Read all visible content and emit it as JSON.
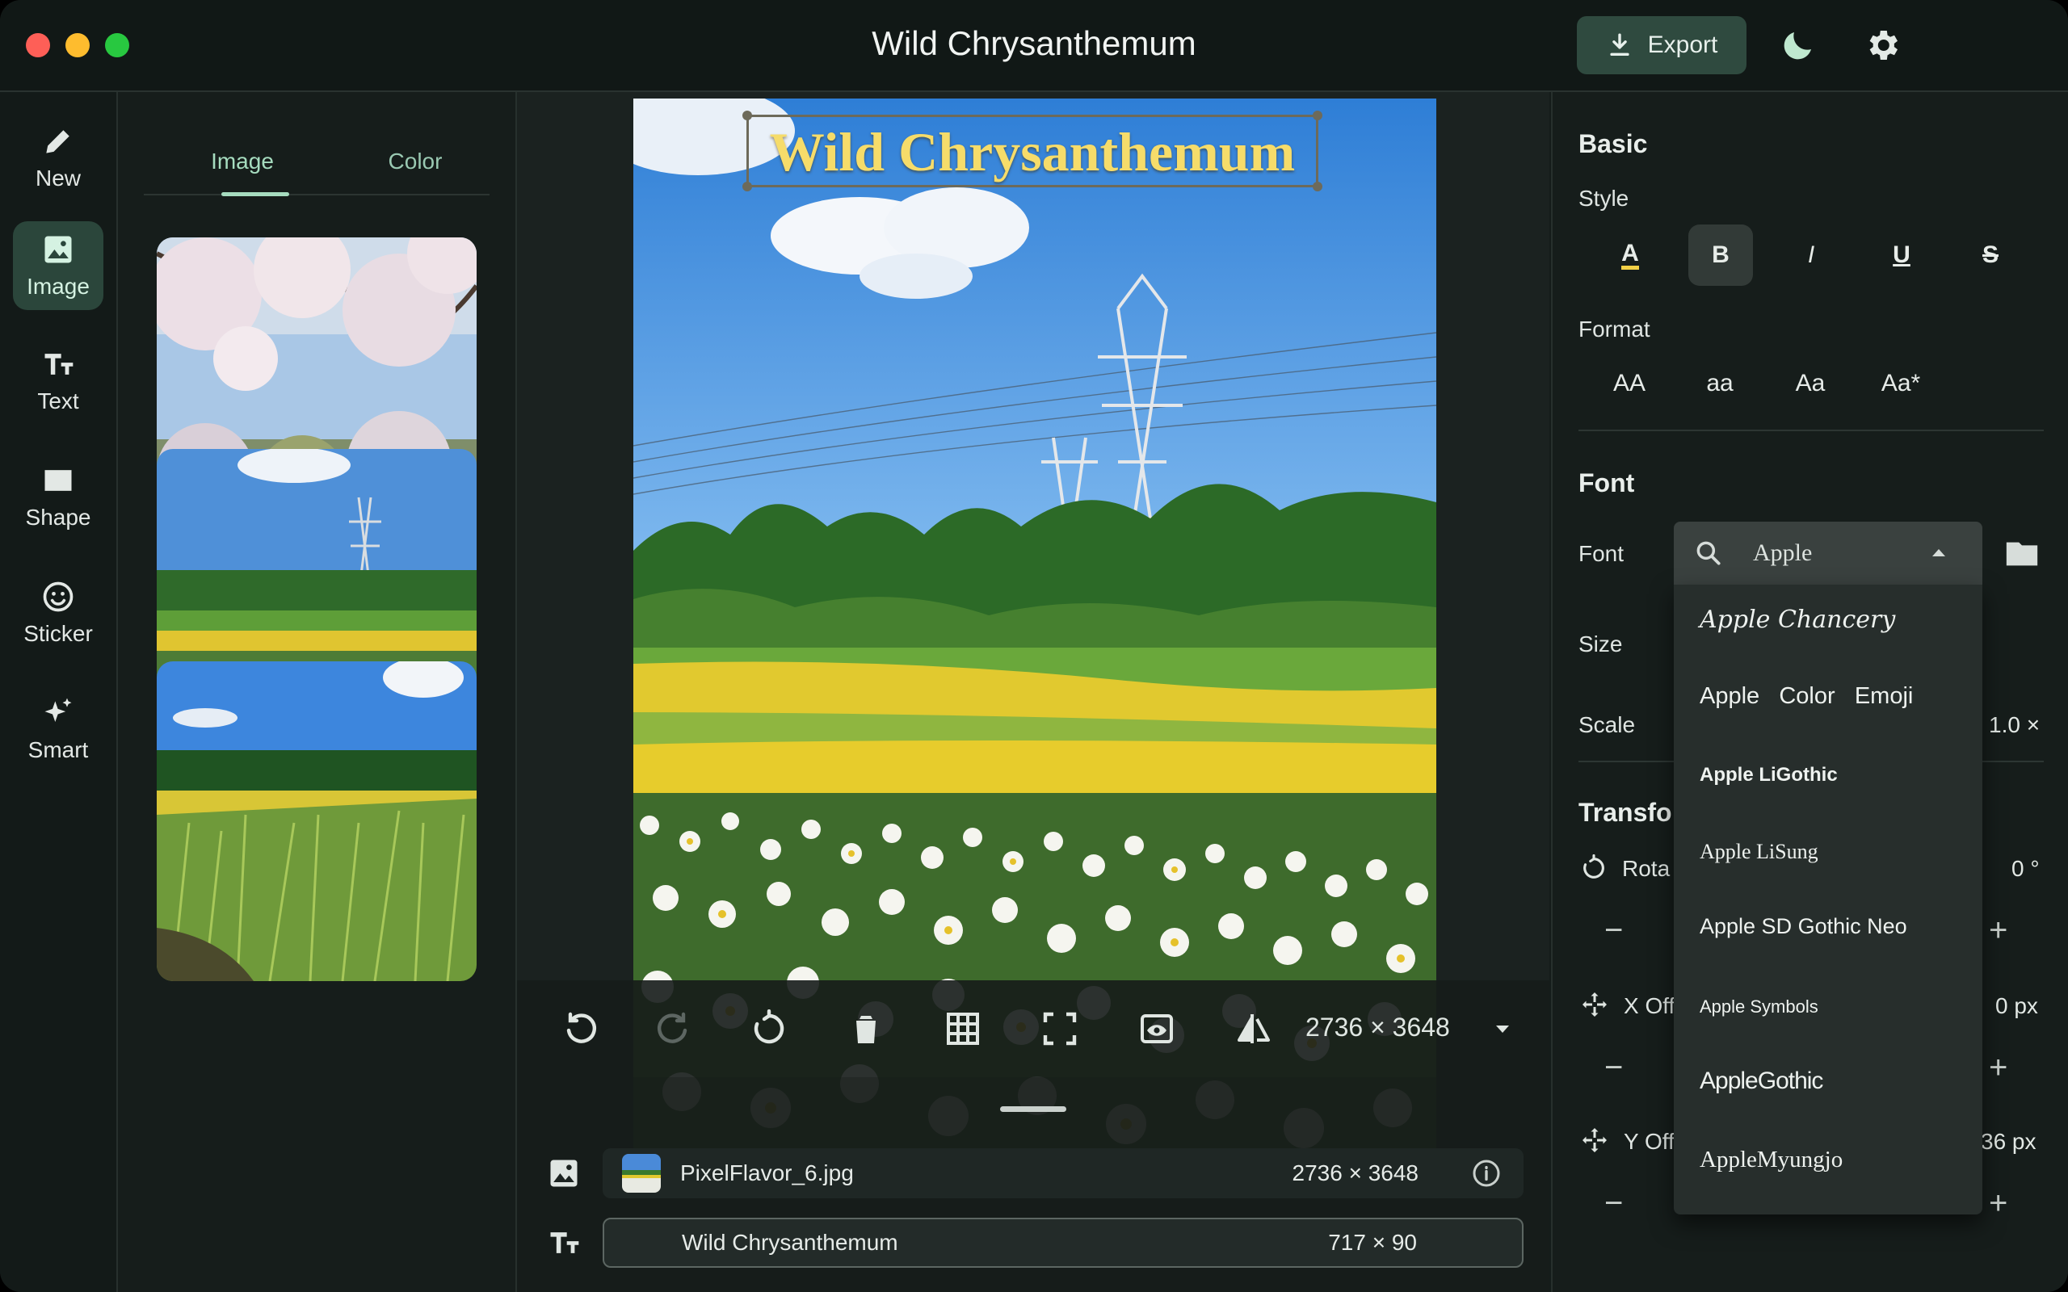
{
  "window": {
    "title": "Wild Chrysanthemum"
  },
  "header": {
    "export_label": "Export",
    "theme_icon": "moon-icon",
    "settings_icon": "gear-icon"
  },
  "rail": {
    "items": [
      {
        "label": "New",
        "icon": "pencil-icon"
      },
      {
        "label": "Image",
        "icon": "image-icon",
        "active": true
      },
      {
        "label": "Text",
        "icon": "text-icon"
      },
      {
        "label": "Shape",
        "icon": "rectangle-icon"
      },
      {
        "label": "Sticker",
        "icon": "smiley-icon"
      },
      {
        "label": "Smart",
        "icon": "sparkle-icon"
      }
    ]
  },
  "gallery": {
    "tabs": [
      {
        "label": "Image",
        "active": true
      },
      {
        "label": "Color"
      }
    ]
  },
  "canvas": {
    "overlay_text": "Wild Chrysanthemum"
  },
  "toolbar": {
    "dimensions": "2736 × 3648"
  },
  "layers": [
    {
      "name": "PixelFlavor_6.jpg",
      "size": "2736 × 3648"
    },
    {
      "name": "Wild Chrysanthemum",
      "size": "717 × 90"
    }
  ],
  "props": {
    "basic": {
      "title": "Basic",
      "style_label": "Style",
      "style_buttons": [
        "A",
        "B",
        "I",
        "U",
        "S"
      ],
      "format_label": "Format",
      "format_buttons": [
        "AA",
        "aa",
        "Aa",
        "Aa*"
      ]
    },
    "font": {
      "title": "Font",
      "font_label": "Font",
      "size_label": "Size",
      "scale_label": "Scale",
      "scale_value": "1.0 ×"
    },
    "transform": {
      "title": "Transfo",
      "rotate_label": "Rota",
      "rotate_value": "0 °",
      "x_label": "X Off",
      "x_value": "0 px",
      "y_label": "Y Off",
      "y_value": "36 px"
    }
  },
  "font_dropdown": {
    "search_value": "Apple",
    "options": [
      "Apple Chancery",
      "Apple   Color   Emoji",
      "Apple LiGothic",
      "Apple LiSung",
      "Apple SD Gothic Neo",
      "Apple Symbols",
      "AppleGothic",
      "AppleMyungjo"
    ]
  },
  "colors": {
    "accent": "#a6dcbf",
    "active_bg": "#2b463b",
    "title_text": "#f6dc6a"
  }
}
